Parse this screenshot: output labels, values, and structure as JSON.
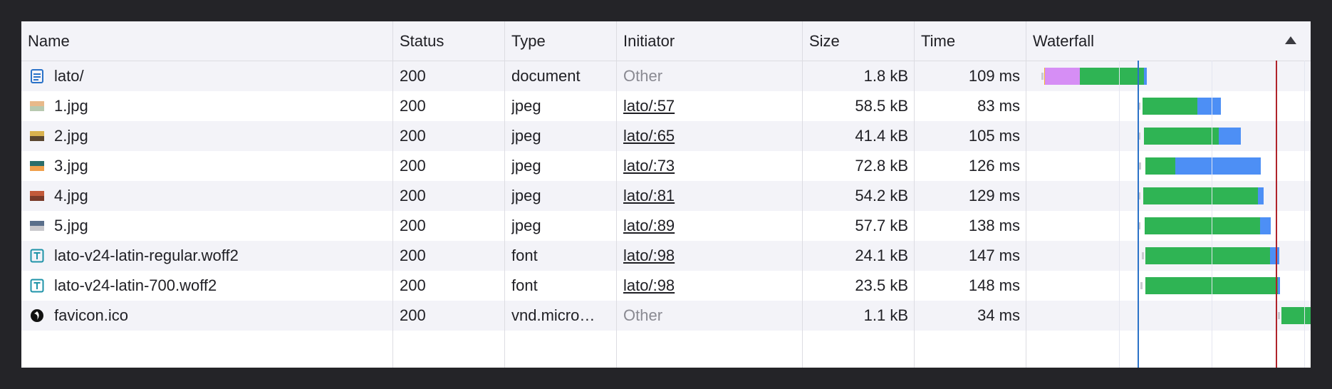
{
  "columns": {
    "name": "Name",
    "status": "Status",
    "type": "Type",
    "initiator": "Initiator",
    "size": "Size",
    "time": "Time",
    "waterfall": "Waterfall"
  },
  "colors": {
    "waiting": "#d68ef5",
    "download": "#2fb454",
    "content": "#4d8ff5",
    "dom_content_loaded_line": "#2a72c8",
    "load_line": "#b0232a",
    "file_icon_blue": "#2a72c8",
    "font_icon_teal": "#1e93a8"
  },
  "rows": [
    {
      "icon": "document-icon",
      "name": "lato/",
      "status": "200",
      "type": "document",
      "initiator": "Other",
      "initiator_link": false,
      "size": "1.8 kB",
      "time": "109 ms"
    },
    {
      "icon": "image-thumbnail-icon",
      "name": "1.jpg",
      "status": "200",
      "type": "jpeg",
      "initiator": "lato/:57",
      "initiator_link": true,
      "size": "58.5 kB",
      "time": "83 ms"
    },
    {
      "icon": "image-thumbnail-icon",
      "name": "2.jpg",
      "status": "200",
      "type": "jpeg",
      "initiator": "lato/:65",
      "initiator_link": true,
      "size": "41.4 kB",
      "time": "105 ms"
    },
    {
      "icon": "image-thumbnail-icon",
      "name": "3.jpg",
      "status": "200",
      "type": "jpeg",
      "initiator": "lato/:73",
      "initiator_link": true,
      "size": "72.8 kB",
      "time": "126 ms"
    },
    {
      "icon": "image-thumbnail-icon",
      "name": "4.jpg",
      "status": "200",
      "type": "jpeg",
      "initiator": "lato/:81",
      "initiator_link": true,
      "size": "54.2 kB",
      "time": "129 ms"
    },
    {
      "icon": "image-thumbnail-icon",
      "name": "5.jpg",
      "status": "200",
      "type": "jpeg",
      "initiator": "lato/:89",
      "initiator_link": true,
      "size": "57.7 kB",
      "time": "138 ms"
    },
    {
      "icon": "font-file-icon",
      "name": "lato-v24-latin-regular.woff2",
      "status": "200",
      "type": "font",
      "initiator": "lato/:98",
      "initiator_link": true,
      "size": "24.1 kB",
      "time": "147 ms"
    },
    {
      "icon": "font-file-icon",
      "name": "lato-v24-latin-700.woff2",
      "status": "200",
      "type": "font",
      "initiator": "lato/:98",
      "initiator_link": true,
      "size": "23.5 kB",
      "time": "148 ms"
    },
    {
      "icon": "favicon-icon",
      "name": "favicon.ico",
      "status": "200",
      "type": "vnd.micro…",
      "initiator": "Other",
      "initiator_link": false,
      "size": "1.1 kB",
      "time": "34 ms"
    }
  ]
}
